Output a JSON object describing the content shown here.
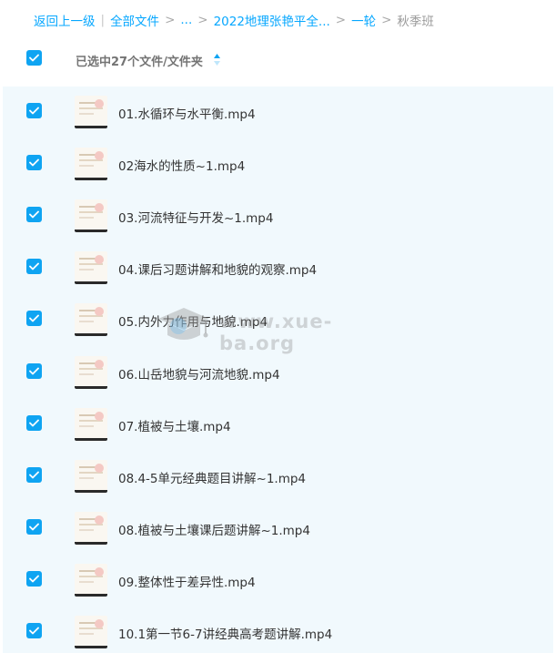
{
  "breadcrumb": {
    "back": "返回上一级",
    "all_files": "全部文件",
    "ellipsis": "...",
    "folder1": "2022地理张艳平全...",
    "folder2": "一轮",
    "current": "秋季班"
  },
  "header": {
    "selection_text": "已选中27个文件/文件夹"
  },
  "files": [
    {
      "name": "01.水循环与水平衡.mp4"
    },
    {
      "name": "02海水的性质~1.mp4"
    },
    {
      "name": "03.河流特征与开发~1.mp4"
    },
    {
      "name": "04.课后习题讲解和地貌的观察.mp4"
    },
    {
      "name": "05.内外力作用与地貌.mp4"
    },
    {
      "name": "06.山岳地貌与河流地貌.mp4"
    },
    {
      "name": "07.植被与土壤.mp4"
    },
    {
      "name": "08.4-5单元经典题目讲解~1.mp4"
    },
    {
      "name": "08.植被与土壤课后题讲解~1.mp4"
    },
    {
      "name": "09.整体性于差异性.mp4"
    },
    {
      "name": "10.1第一节6-7讲经典高考题讲解.mp4"
    }
  ],
  "watermark": {
    "text": "www.xue-ba.org"
  },
  "colors": {
    "accent": "#06a7ff",
    "checkbox": "#0fa4f2",
    "list_bg": "#f1f9fd"
  }
}
